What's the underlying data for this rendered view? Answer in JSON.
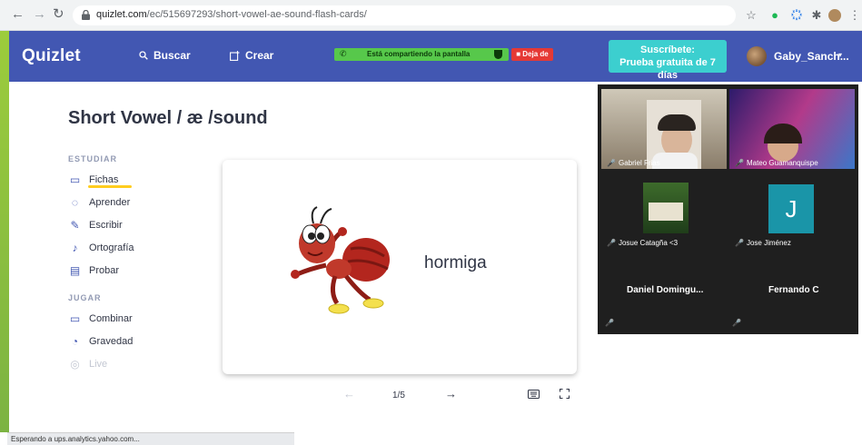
{
  "browser": {
    "url_host": "quizlet.com",
    "url_path": "/ec/515697293/short-vowel-ae-sound-flash-cards/"
  },
  "header": {
    "logo": "Quizlet",
    "search_label": "Buscar",
    "create_label": "Crear",
    "share_text": "Está compartiendo la pantalla",
    "stop_share_label": "Deja de",
    "subscribe_line1": "Suscríbete:",
    "subscribe_line2": "Prueba gratuita de 7 días",
    "user_name": "Gaby_Sanch..."
  },
  "set": {
    "title": "Short Vowel / æ /sound"
  },
  "sidebar": {
    "study_label": "ESTUDIAR",
    "study_modes": [
      {
        "label": "Fichas",
        "icon": "cards-icon"
      },
      {
        "label": "Aprender",
        "icon": "learn-icon"
      },
      {
        "label": "Escribir",
        "icon": "write-icon"
      },
      {
        "label": "Ortografía",
        "icon": "spell-icon"
      },
      {
        "label": "Probar",
        "icon": "test-icon"
      }
    ],
    "play_label": "JUGAR",
    "play_modes": [
      {
        "label": "Combinar",
        "icon": "match-icon"
      },
      {
        "label": "Gravedad",
        "icon": "gravity-icon"
      },
      {
        "label": "Live",
        "icon": "live-icon"
      }
    ]
  },
  "card": {
    "term": "hormiga",
    "image": "ant-illustration"
  },
  "controls": {
    "prev": "←",
    "position": "1/5",
    "next": "→"
  },
  "video_call": {
    "participants": [
      {
        "name": "Gabriel Frias"
      },
      {
        "name": "Mateo Guamanquispe"
      },
      {
        "name": "Josue Catagña <3"
      },
      {
        "name": "Jose Jiménez",
        "initial": "J"
      },
      {
        "name": "Daniel  Domingu..."
      },
      {
        "name": "Fernando C"
      }
    ]
  },
  "status_bar": {
    "text": "Esperando a ups.analytics.yahoo.com..."
  },
  "colors": {
    "header_bg": "#4257b2",
    "subscribe_bg": "#3ccfcf",
    "share_bar": "#57c84b",
    "stop_btn": "#e53935",
    "underline": "#ffcd1f"
  }
}
